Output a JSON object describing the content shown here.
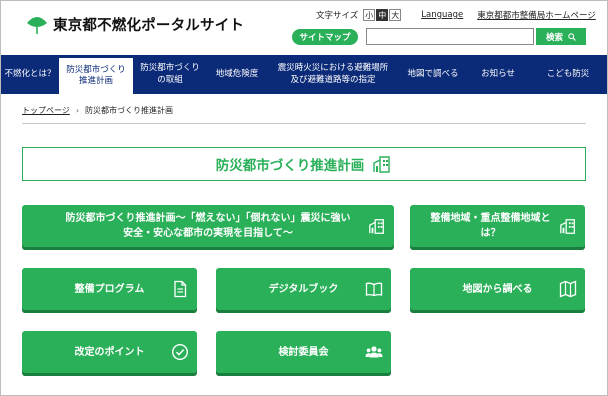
{
  "header": {
    "site_title": "東京都不燃化ポータルサイト",
    "font_size_label": "文字サイズ",
    "font_sizes": [
      "小",
      "中",
      "大"
    ],
    "font_size_selected": "中",
    "language_label": "Language",
    "bureau_link": "東京都都市整備局ホームページ",
    "sitemap_label": "サイトマップ",
    "search_value": "",
    "search_button_label": "検索"
  },
  "nav": {
    "items": [
      {
        "label": "不燃化とは？"
      },
      {
        "label": "防災都市づくり\n推進計画"
      },
      {
        "label": "防災都市づくり\nの取組"
      },
      {
        "label": "地域危険度"
      },
      {
        "label": "震災時火災における避難場所\n及び避難道路等の指定"
      },
      {
        "label": "地図で調べる"
      },
      {
        "label": "お知らせ"
      },
      {
        "label": "こども防災"
      }
    ],
    "active_index": 1
  },
  "breadcrumb": {
    "home": "トップページ",
    "current": "防災都市づくり推進計画"
  },
  "page_title": "防災都市づくり推進計画",
  "cards": [
    {
      "label": "防災都市づくり推進計画〜「燃えない」「倒れない」震災に強い\n安全・安心な都市の実現を目指して〜",
      "icon": "building-icon"
    },
    {
      "label": "整備地域・重点整備地域と\nは？",
      "icon": "building-icon"
    },
    {
      "label": "整備プログラム",
      "icon": "document-icon"
    },
    {
      "label": "デジタルブック",
      "icon": "book-icon"
    },
    {
      "label": "地図から調べる",
      "icon": "map-icon"
    },
    {
      "label": "改定のポイント",
      "icon": "check-circle-icon"
    },
    {
      "label": "検討委員会",
      "icon": "group-icon"
    }
  ],
  "colors": {
    "brand_green": "#2bb05a",
    "nav_navy": "#0b2a78"
  }
}
